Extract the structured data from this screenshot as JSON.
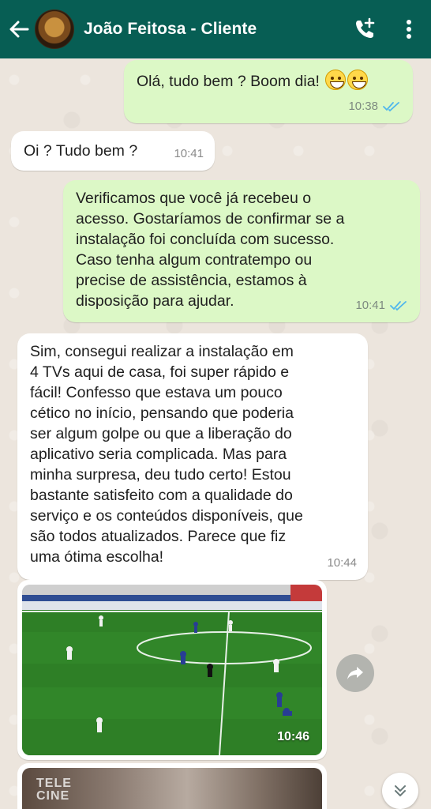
{
  "header": {
    "title": "João Feitosa - Cliente",
    "back_icon": "arrow-left-icon",
    "call_icon": "add-call-icon",
    "menu_icon": "more-vert-icon",
    "bg_color": "#075e54"
  },
  "messages": [
    {
      "direction": "out",
      "text": "Olá, tudo bem ? Boom dia!",
      "emoji": "grinning-face-x2",
      "time": "10:38",
      "status": "read"
    },
    {
      "direction": "in",
      "text": "Oi ? Tudo bem ?",
      "time": "10:41"
    },
    {
      "direction": "out",
      "lines": [
        "Verificamos que você já recebeu o",
        "acesso. Gostaríamos de confirmar se a",
        "instalação foi concluída com sucesso.",
        "Caso tenha algum contratempo ou",
        "precise de assistência, estamos à",
        "disposição para ajudar."
      ],
      "time": "10:41",
      "status": "read"
    },
    {
      "direction": "in",
      "lines": [
        "Sim, consegui realizar a instalação em",
        "4 TVs aqui de casa, foi super rápido e",
        "fácil! Confesso que estava um pouco",
        "cético no início, pensando que poderia",
        "ser algum golpe ou que a liberação do",
        "aplicativo seria complicada. Mas para",
        "minha surpresa, deu tudo certo! Estou",
        "bastante satisfeito com a qualidade do",
        "serviço e os conteúdos disponíveis, que",
        "são todos atualizados. Parece que fiz",
        "uma ótima escolha!"
      ],
      "time": "10:44"
    },
    {
      "direction": "in",
      "type": "image",
      "description_icon": "soccer-field-image",
      "time": "10:46"
    },
    {
      "direction": "in",
      "type": "image",
      "overlay_text": [
        "TELE",
        "CINE"
      ]
    }
  ],
  "share_icon": "share-arrow-icon",
  "scroll_icon": "double-chevron-down-icon",
  "colors": {
    "out_bubble": "#dcf8c6",
    "in_bubble": "#ffffff",
    "read_ticks": "#4fb6ec"
  }
}
